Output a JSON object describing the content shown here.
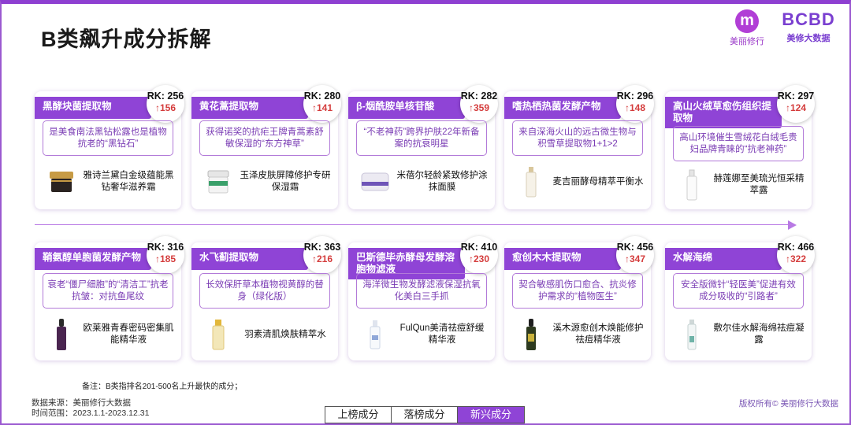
{
  "title": "B类飙升成分拆解",
  "brand": {
    "logo1_glyph": "m",
    "logo1_label": "美丽修行",
    "logo2_mark": "BCBD",
    "logo2_label": "美修大数据"
  },
  "cards": [
    {
      "name": "黑酵块菌提取物",
      "rank": "RK: 256",
      "delta": "↑156",
      "desc": "是美食南法黑钻松露也是植物抗老的“黑钻石”",
      "product": "雅诗兰黛白金级蕴能黑钻奢华滋养霜"
    },
    {
      "name": "黄花蒿提取物",
      "rank": "RK: 280",
      "delta": "↑141",
      "desc": "获得诺奖的抗疟王牌青蒿素舒敏保湿的“东方神草”",
      "product": "玉泽皮肤屏障修护专研保湿霜"
    },
    {
      "name": "β-烟酰胺单核苷酸",
      "rank": "RK: 282",
      "delta": "↑359",
      "desc": "“不老神药”跨界护肤22年新备案的抗衰明星",
      "product": "米蓓尔轻龄紧致修护涂抹面膜"
    },
    {
      "name": "嗜热栖热菌发酵产物",
      "rank": "RK: 296",
      "delta": "↑148",
      "desc": "来自深海火山的远古微生物与积雪草提取物1+1>2",
      "product": "麦吉丽酵母精萃平衡水"
    },
    {
      "name": "高山火绒草愈伤组织提取物",
      "rank": "RK: 297",
      "delta": "↑124",
      "desc": "高山环境催生雪绒花白绒毛贵妇品牌青睐的“抗老神药”",
      "product": "赫莲娜至美琉光恒采精萃露"
    },
    {
      "name": "鞘氨醇单胞菌发酵产物",
      "rank": "RK: 316",
      "delta": "↑185",
      "desc": "衰老“僵尸细胞”的“清洁工”抗老抗皱：对抗鱼尾纹",
      "product": "欧莱雅青春密码密集肌能精华液"
    },
    {
      "name": "水飞蓟提取物",
      "rank": "RK: 363",
      "delta": "↑216",
      "desc": "长效保肝草本植物视黄醇的替身（绿化版）",
      "product": "羽素清肌焕肤精萃水"
    },
    {
      "name": "巴斯德毕赤酵母发酵溶胞物滤液",
      "rank": "RK: 410",
      "delta": "↑230",
      "desc": "海洋微生物发酵滤液保湿抗氧化美白三手抓",
      "product": "FulQun美清祛痘舒缓精华液"
    },
    {
      "name": "愈创木木提取物",
      "rank": "RK: 456",
      "delta": "↑347",
      "desc": "契合敏感肌伤口愈合、抗炎修护需求的“植物医生”",
      "product": "溪木源愈创木焕能修护祛痘精华液"
    },
    {
      "name": "水解海绵",
      "rank": "RK: 466",
      "delta": "↑322",
      "desc": "安全版微针“轻医美”促进有效成分吸收的“引路者”",
      "product": "敷尔佳水解海绵祛痘凝露"
    }
  ],
  "note": "备注：B类指排名201-500名上升最快的成分；",
  "source_line": "数据来源：美丽修行大数据",
  "range_line": "时间范围：2023.1.1-2023.12.31",
  "copyright": "版权所有© 美丽修行大数据",
  "tabs": [
    "上榜成分",
    "落榜成分",
    "新兴成分"
  ],
  "active_tab": 2,
  "colors": {
    "accent": "#8f44d6",
    "rank_delta": "#d43c3c",
    "desc_text": "#7a3cb4"
  }
}
